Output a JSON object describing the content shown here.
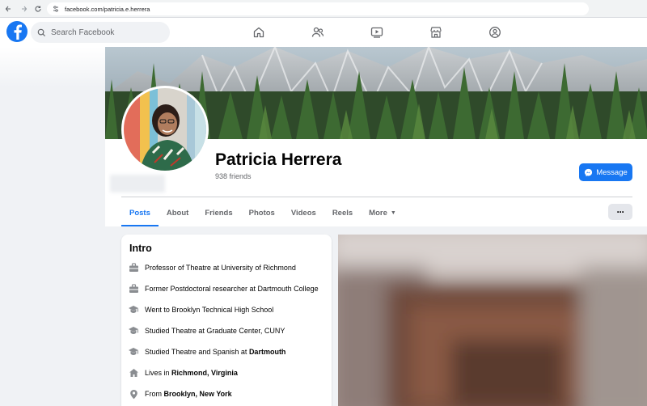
{
  "browser": {
    "url": "facebook.com/patricia.e.herrera"
  },
  "header": {
    "search_placeholder": "Search Facebook",
    "nav_icons": [
      "home-icon",
      "friends-icon",
      "watch-icon",
      "marketplace-icon",
      "groups-icon"
    ]
  },
  "profile": {
    "name": "Patricia Herrera",
    "friends": "938 friends",
    "message_label": "Message"
  },
  "tabs": [
    {
      "label": "Posts",
      "active": true
    },
    {
      "label": "About"
    },
    {
      "label": "Friends"
    },
    {
      "label": "Photos"
    },
    {
      "label": "Videos"
    },
    {
      "label": "Reels"
    },
    {
      "label": "More"
    }
  ],
  "more_dots": "···",
  "intro": {
    "title": "Intro",
    "items": [
      {
        "icon": "briefcase-icon",
        "text": "Professor of Theatre at University of Richmond",
        "bold": ""
      },
      {
        "icon": "briefcase-icon",
        "text": "Former Postdoctoral researcher at Dartmouth College",
        "bold": ""
      },
      {
        "icon": "graduation-cap-icon",
        "text": "Went to Brooklyn Technical High School",
        "bold": ""
      },
      {
        "icon": "graduation-cap-icon",
        "text": "Studied Theatre at Graduate Center, CUNY",
        "bold": ""
      },
      {
        "icon": "graduation-cap-icon",
        "text": "Studied Theatre and Spanish at ",
        "bold": "Dartmouth"
      },
      {
        "icon": "home-icon",
        "text": "Lives in ",
        "bold": "Richmond, Virginia"
      },
      {
        "icon": "location-pin-icon",
        "text": "From ",
        "bold": "Brooklyn, New York"
      }
    ]
  },
  "colors": {
    "brand_blue": "#1877f2",
    "page_bg": "#f0f2f5",
    "secondary_text": "#65676b"
  }
}
